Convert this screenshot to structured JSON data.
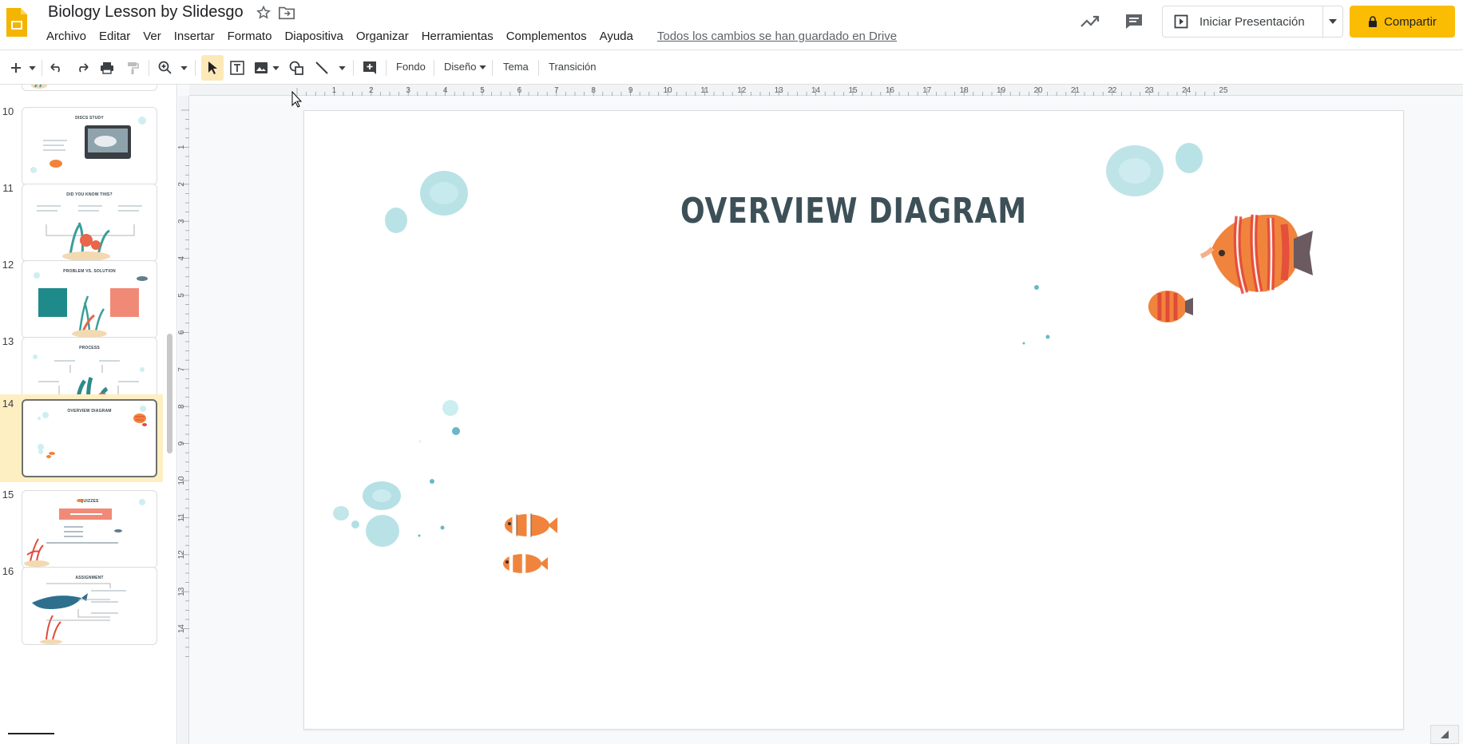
{
  "header": {
    "doc_title": "Biology Lesson by Slidesgo",
    "menu": [
      "Archivo",
      "Editar",
      "Ver",
      "Insertar",
      "Formato",
      "Diapositiva",
      "Organizar",
      "Herramientas",
      "Complementos",
      "Ayuda"
    ],
    "saved_status": "Todos los cambios se han guardado en Drive",
    "present_label": "Iniciar Presentación",
    "share_label": "Compartir"
  },
  "toolbar": {
    "fondo": "Fondo",
    "diseno": "Diseño",
    "tema": "Tema",
    "transicion": "Transición"
  },
  "ruler": {
    "h_ticks": [
      "1",
      "2",
      "3",
      "4",
      "5",
      "6",
      "7",
      "8",
      "9",
      "10",
      "11",
      "12",
      "13",
      "14",
      "15",
      "16",
      "17",
      "18",
      "19",
      "20",
      "21",
      "22",
      "23",
      "24",
      "25"
    ],
    "v_ticks": [
      "1",
      "2",
      "3",
      "4",
      "5",
      "6",
      "7",
      "8",
      "9",
      "10",
      "11",
      "12",
      "13",
      "14"
    ]
  },
  "filmstrip": {
    "slides": [
      {
        "num": "10",
        "title": "DISCS STUDY"
      },
      {
        "num": "11",
        "title": "DID YOU KNOW THIS?"
      },
      {
        "num": "12",
        "title": "PROBLEM VS. SOLUTION"
      },
      {
        "num": "13",
        "title": "PROCESS"
      },
      {
        "num": "14",
        "title": "OVERVIEW DIAGRAM"
      },
      {
        "num": "15",
        "title": "QUIZZES"
      },
      {
        "num": "16",
        "title": "ASSIGNMENT"
      }
    ]
  },
  "slide": {
    "title": "OVERVIEW DIAGRAM"
  },
  "colors": {
    "share": "#fbbc04",
    "slide_title": "#3d5058",
    "bubble": "#a8dbe0",
    "fish_orange": "#f0843c",
    "fish_red": "#e24a3b"
  }
}
